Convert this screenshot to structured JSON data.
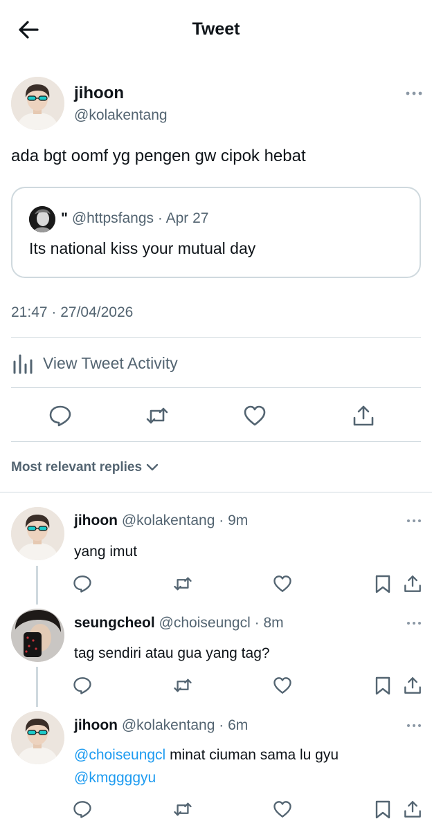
{
  "header": {
    "title": "Tweet",
    "back_icon": "arrow-left-icon"
  },
  "main_tweet": {
    "author_name": "jihoon",
    "author_handle": "@kolakentang",
    "text": "ada bgt oomf yg pengen gw cipok hebat",
    "quoted": {
      "name": "\"",
      "handle": "@httpsfangs",
      "date": "Apr 27",
      "text": "Its national kiss your mutual day"
    },
    "timestamp": "21:47 · 27/04/2026",
    "activity_label": "View Tweet Activity",
    "actions": [
      "reply-icon",
      "retweet-icon",
      "like-icon",
      "share-icon"
    ]
  },
  "replies_sort": {
    "label": "Most relevant replies"
  },
  "replies": [
    {
      "name": "jihoon",
      "handle": "@kolakentang",
      "time": "9m",
      "text": "yang imut"
    },
    {
      "name": "seungcheol",
      "handle": "@choiseungcl",
      "time": "8m",
      "text": "tag sendiri atau gua yang tag?"
    },
    {
      "name": "jihoon",
      "handle": "@kolakentang",
      "time": "6m",
      "mention_1": "@choiseungcl",
      "text": " minat ciuman sama lu gyu",
      "mention_2": "@kmggggyu"
    }
  ],
  "colors": {
    "text": "#0f1419",
    "secondary": "#536471",
    "link": "#1d9bf0",
    "border": "#cfd9de"
  }
}
